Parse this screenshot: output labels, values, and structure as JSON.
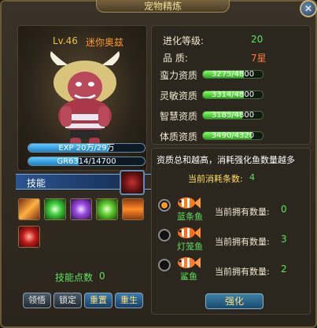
{
  "window": {
    "title": "宠物精炼"
  },
  "pet": {
    "level": "Lv.46",
    "name": "迷你奥兹"
  },
  "bars": {
    "exp_text": "EXP 20万/29万",
    "exp_fraction": 0.69,
    "gr_text": "GR6314/14700",
    "gr_fraction": 0.43
  },
  "skills": {
    "header": "技能",
    "points_label": "技能点数",
    "points_value": "0",
    "icons": [
      "slash-skill-icon",
      "green-burst-skill-icon",
      "purple-vortex-skill-icon",
      "green-shock-skill-icon",
      "fire-arrow-skill-icon",
      "claw-skill-icon"
    ]
  },
  "buttons": {
    "lock": "领悟",
    "fix": "锁定",
    "reset": "重置",
    "reborn": "重生"
  },
  "stats": {
    "advance_label": "进化等级:",
    "advance_value": "20",
    "quality_label": "品    质:",
    "quality_value": "7星",
    "rows": [
      {
        "label": "蛮力资质",
        "text": "3275/4800",
        "fraction": 0.68
      },
      {
        "label": "灵敏资质",
        "text": "3314/4800",
        "fraction": 0.69
      },
      {
        "label": "智慧资质",
        "text": "3185/4800",
        "fraction": 0.66
      },
      {
        "label": "体质资质",
        "text": "3490/4320",
        "fraction": 0.81
      }
    ]
  },
  "refine": {
    "info": "资质总和越高，消耗强化鱼数量越多",
    "consume_label": "当前消耗条数:",
    "consume_value": "4",
    "own_label": "当前拥有数量:",
    "fish": [
      {
        "name": "蓝条鱼",
        "count": "0",
        "selected": true
      },
      {
        "name": "灯笼鱼",
        "count": "3",
        "selected": false
      },
      {
        "name": "鲨鱼",
        "count": "2",
        "selected": false
      }
    ],
    "button": "强化"
  },
  "colors": {
    "accent_green": "#5fe05f",
    "accent_orange": "#ff9a1a",
    "title_gold": "#f3df9a"
  }
}
